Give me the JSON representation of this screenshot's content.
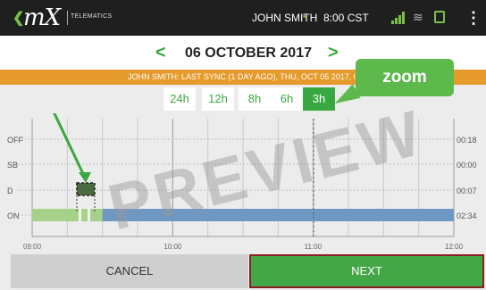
{
  "header": {
    "logo_text": "mX",
    "logo_sub": "TELEMATICS",
    "user_name": "JOHN SMITH",
    "time": "8:00 CST",
    "icons": [
      "back-arrow-icon",
      "driver-status-icon",
      "signal-icon",
      "wifi-icon",
      "truck-icon",
      "more-menu-icon"
    ],
    "accent_color": "#7ac043"
  },
  "date_nav": {
    "date": "06 OCTOBER 2017",
    "prev_symbol": "<",
    "next_symbol": ">"
  },
  "sync_bar": {
    "text": "JOHN SMITH: LAST SYNC (1 DAY AGO), THU, OCT 05 2017, 0",
    "color": "#e69a2c"
  },
  "zoom": {
    "options": [
      "24h",
      "12h",
      "8h",
      "6h",
      "3h"
    ],
    "selected": "3h"
  },
  "callout": {
    "label": "zoom"
  },
  "chart_data": {
    "type": "timeline",
    "rows": [
      "OFF",
      "SB",
      "D",
      "ON"
    ],
    "row_totals": [
      "00:18",
      "00:00",
      "00:07",
      "02:34"
    ],
    "x_ticks": [
      "09:00",
      "10:00",
      "11:00",
      "12:00"
    ],
    "segments": [
      {
        "status": "ON",
        "start": "09:00",
        "end": "09:30",
        "color": "#a6d18a"
      },
      {
        "status": "ON",
        "start": "09:30",
        "end": "12:00",
        "color": "#6e98c2"
      }
    ],
    "highlight": {
      "status": "D",
      "label": "D marker"
    }
  },
  "watermark": "PREVIEW",
  "footer": {
    "cancel_label": "CANCEL",
    "next_label": "NEXT"
  }
}
